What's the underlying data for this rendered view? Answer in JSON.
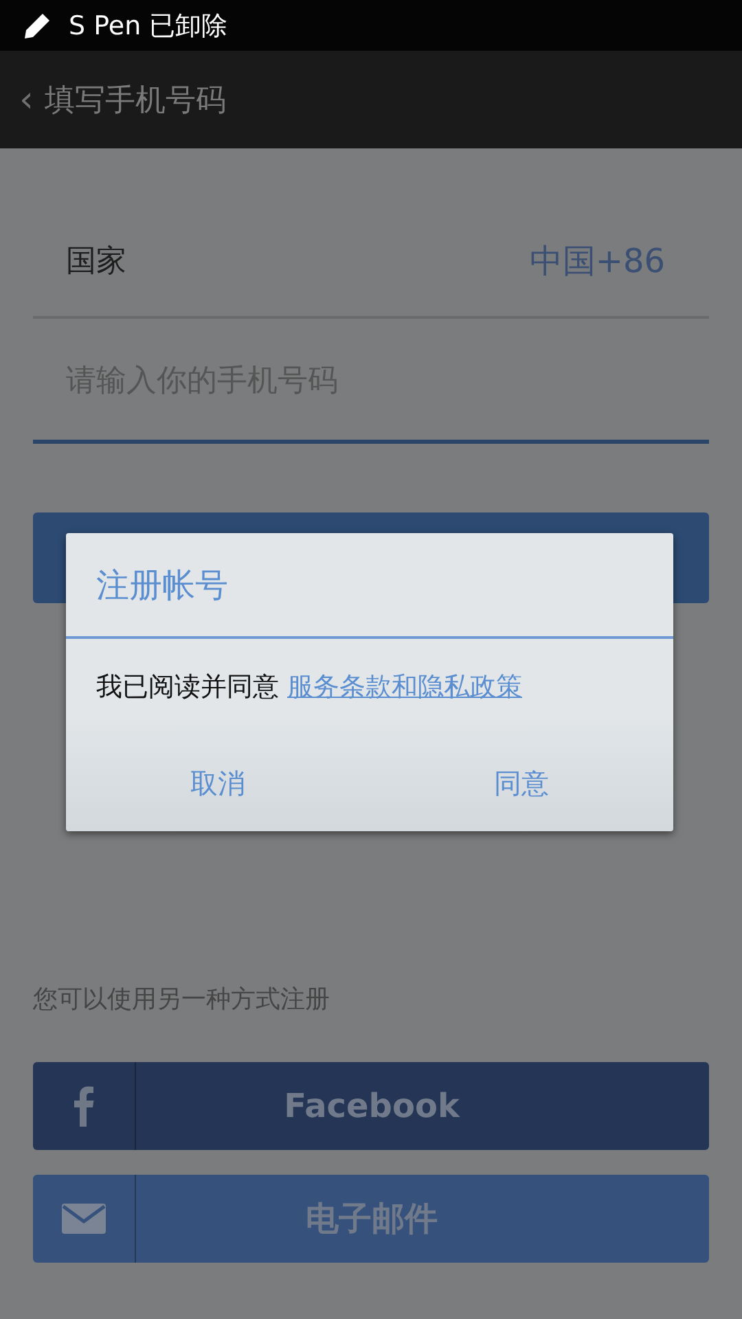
{
  "status_bar": {
    "text": "S Pen 已卸除"
  },
  "header": {
    "back": "‹",
    "title": "填写手机号码"
  },
  "country": {
    "label": "国家",
    "value": "中国+86"
  },
  "phone_field": {
    "placeholder": "请输入你的手机号码"
  },
  "alternative": {
    "hint": "您可以使用另一种方式注册",
    "buttons": [
      {
        "kind": "facebook",
        "label": "Facebook"
      },
      {
        "kind": "email",
        "label": "电子邮件"
      }
    ]
  },
  "dialog": {
    "title": "注册帐号",
    "message": "我已阅读并同意",
    "link": "服务条款和隐私政策",
    "buttons": [
      "取消",
      "同意"
    ]
  }
}
